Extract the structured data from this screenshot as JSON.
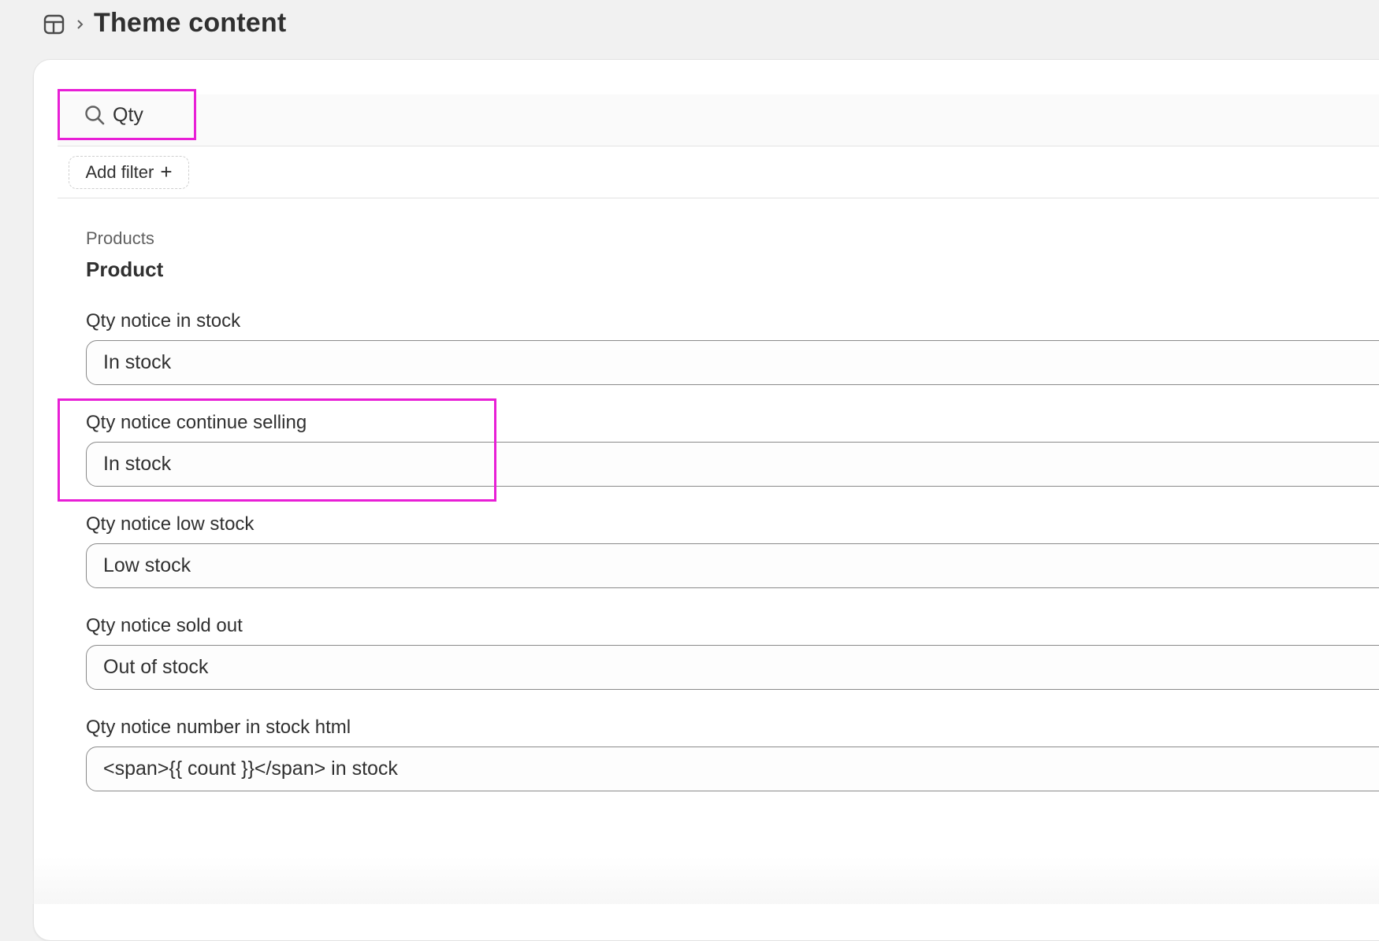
{
  "breadcrumb": {
    "icon": "store-icon",
    "separator_icon": "chevron-right-icon",
    "title": "Theme content"
  },
  "search": {
    "icon": "search-icon",
    "value": "Qty"
  },
  "filter": {
    "label": "Add filter",
    "plus": "+"
  },
  "section": {
    "label": "Products",
    "title": "Product"
  },
  "fields": [
    {
      "label": "Qty notice in stock",
      "value": "In stock"
    },
    {
      "label": "Qty notice continue selling",
      "value": "In stock"
    },
    {
      "label": "Qty notice low stock",
      "value": "Low stock"
    },
    {
      "label": "Qty notice sold out",
      "value": "Out of stock"
    },
    {
      "label": "Qty notice number in stock html",
      "value": "<span>{{ count }}</span> in stock"
    }
  ],
  "colors": {
    "highlight": "#e81fd6",
    "background": "#f1f1f1",
    "card": "#ffffff",
    "text": "#303030"
  }
}
